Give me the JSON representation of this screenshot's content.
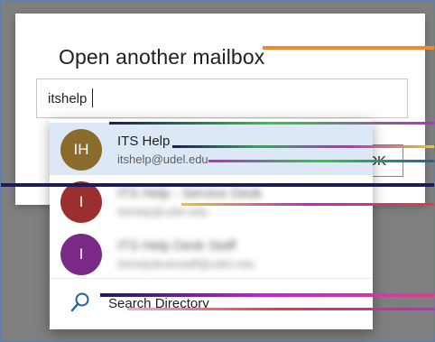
{
  "dialog": {
    "title": "Open another mailbox",
    "input_value": "itshelp",
    "ok_label": "OK"
  },
  "suggestions": [
    {
      "initials": "IH",
      "name": "ITS Help",
      "email": "itshelp@udel.edu",
      "avatar_color": "#8b6b2c",
      "selected": true
    },
    {
      "initials": "I",
      "name": "ITS Help - Service Desk",
      "email": "itshelp@udel.edu",
      "avatar_color": "#9b2f2f",
      "selected": false
    },
    {
      "initials": "I",
      "name": "ITS Help Desk Staff",
      "email": "itshelpdeskstaff@udel.edu",
      "avatar_color": "#7a2a86",
      "selected": false
    }
  ],
  "search_directory": {
    "icon": "search-icon",
    "label": "Search Directory"
  },
  "colors": {
    "overlay": "#7f7f7f",
    "selected_row": "#dde8f6",
    "frame_border": "#5b7fa8"
  }
}
